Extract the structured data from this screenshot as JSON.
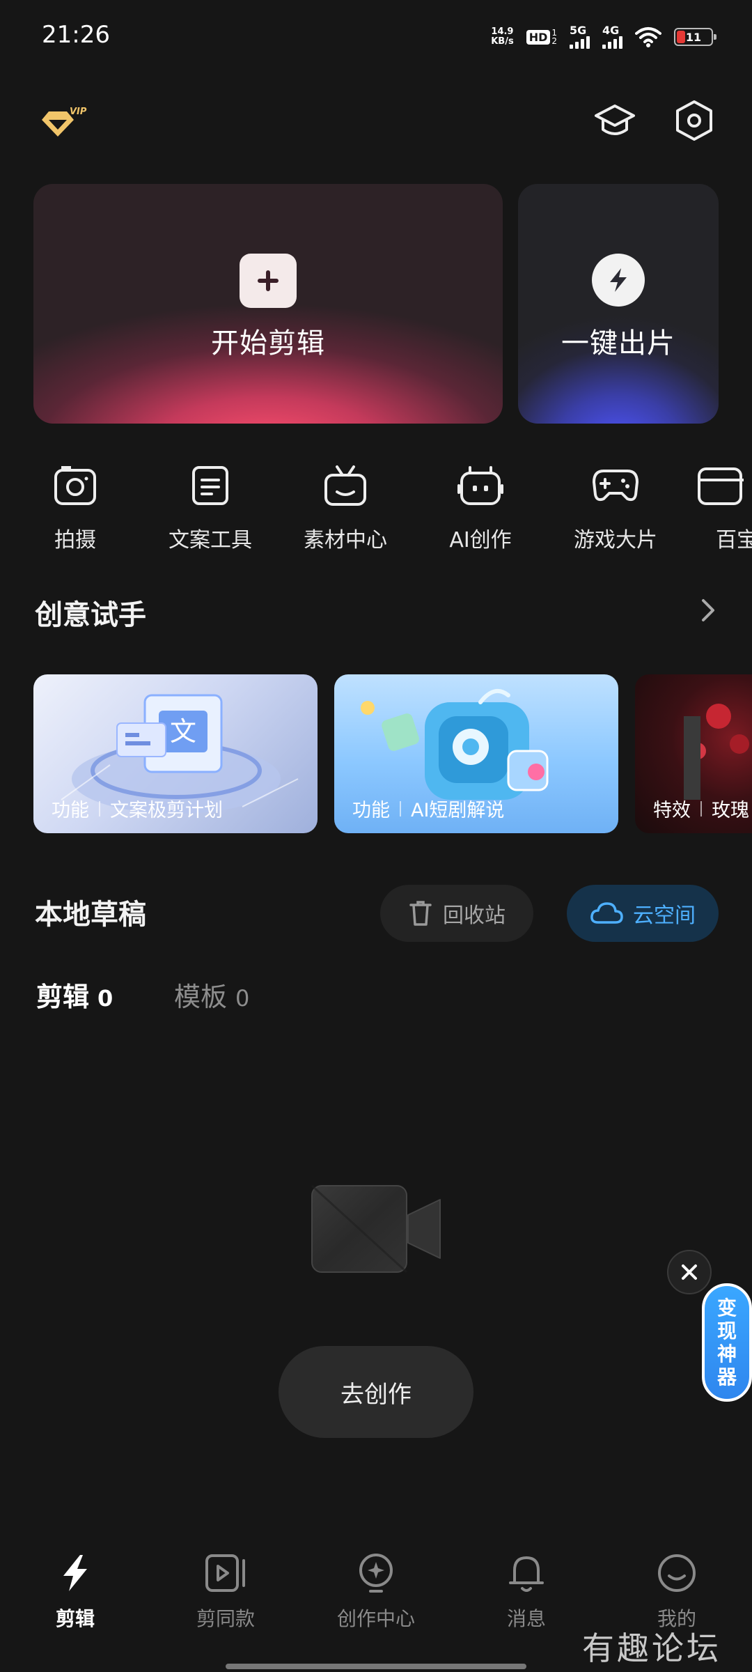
{
  "status_bar": {
    "time": "21:26",
    "net_speed_value": "14.9",
    "net_speed_unit": "KB/s",
    "hd_label": "HD",
    "hd_sub_top": "1",
    "hd_sub_bottom": "2",
    "signal_1_label": "5G",
    "signal_2_label": "4G",
    "battery_level": "11",
    "battery_color": "#e53935"
  },
  "header": {
    "vip_badge": "VIP",
    "icons": [
      "graduation-cap-icon",
      "settings-hexagon-icon"
    ]
  },
  "hero": {
    "start_edit": {
      "label": "开始剪辑",
      "icon": "plus-icon"
    },
    "one_click": {
      "label": "一键出片",
      "icon": "bolt-icon"
    }
  },
  "tools": [
    {
      "label": "拍摄",
      "icon": "camera-icon"
    },
    {
      "label": "文案工具",
      "icon": "document-icon"
    },
    {
      "label": "素材中心",
      "icon": "tv-icon"
    },
    {
      "label": "AI创作",
      "icon": "robot-icon"
    },
    {
      "label": "游戏大片",
      "icon": "gamepad-icon"
    },
    {
      "label": "百宝",
      "icon": "box-icon"
    }
  ],
  "creative": {
    "title": "创意试手",
    "cards": [
      {
        "tag": "功能",
        "name": "文案极剪计划"
      },
      {
        "tag": "功能",
        "name": "AI短剧解说"
      },
      {
        "tag": "特效",
        "name": "玫瑰"
      }
    ]
  },
  "drafts": {
    "title": "本地草稿",
    "recycle_label": "回收站",
    "cloud_label": "云空间",
    "tabs": [
      {
        "label": "剪辑",
        "count": "0"
      },
      {
        "label": "模板",
        "count": "0"
      }
    ],
    "go_create_label": "去创作"
  },
  "floating": {
    "promo_chars": [
      "变",
      "现",
      "神",
      "器"
    ]
  },
  "bottom_nav": [
    {
      "label": "剪辑",
      "icon": "bolt-icon",
      "active": true
    },
    {
      "label": "剪同款",
      "icon": "video-play-icon",
      "active": false
    },
    {
      "label": "创作中心",
      "icon": "lightbulb-icon",
      "active": false
    },
    {
      "label": "消息",
      "icon": "bell-icon",
      "active": false
    },
    {
      "label": "我的",
      "icon": "smile-icon",
      "active": false
    }
  ],
  "watermark": "有趣论坛",
  "colors": {
    "background": "#161616",
    "accent_blue": "#3aa7ff",
    "start_card_glow": "#ff4f6e",
    "one_click_glow": "#4f55ff"
  }
}
